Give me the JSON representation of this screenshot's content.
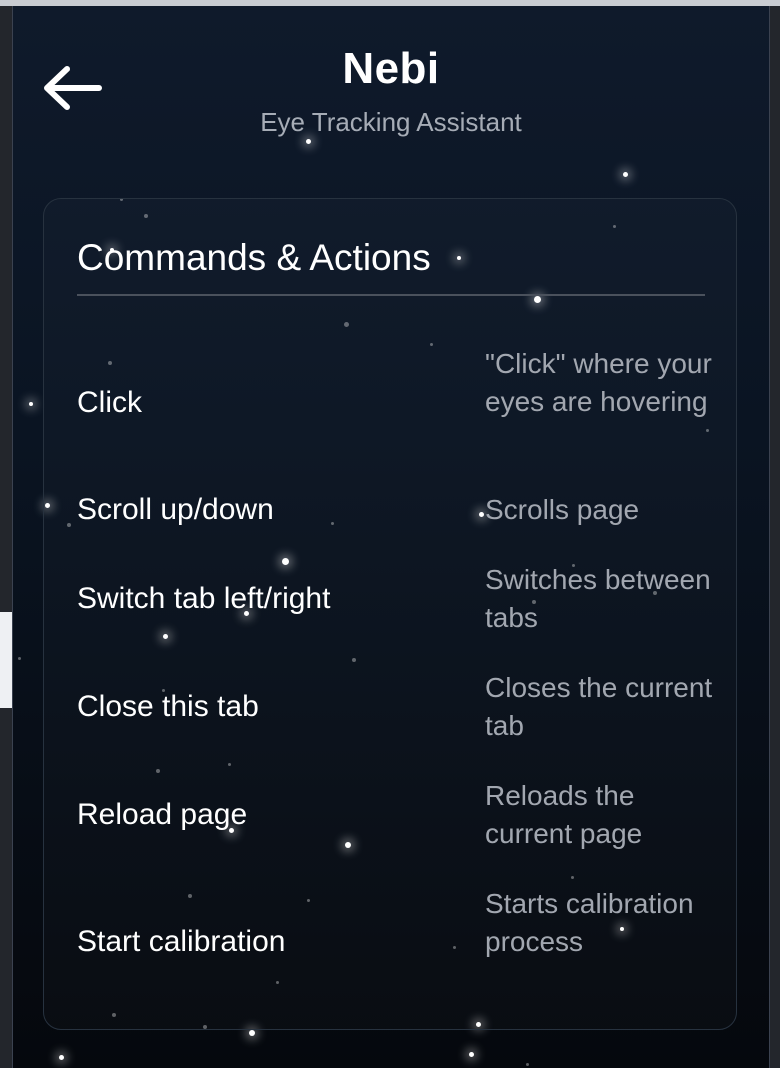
{
  "header": {
    "title": "Nebi",
    "subtitle": "Eye Tracking Assistant",
    "back_icon": "arrow-left-icon"
  },
  "card": {
    "title": "Commands & Actions"
  },
  "commands": [
    {
      "name": "Click",
      "desc": "\"Click\" where your eyes are hovering"
    },
    {
      "name": "Scroll up/down",
      "desc": "Scrolls page"
    },
    {
      "name": "Switch tab left/right",
      "desc": "Switches between tabs"
    },
    {
      "name": "Close this tab",
      "desc": "Closes the current tab"
    },
    {
      "name": "Reload page",
      "desc": "Reloads the current page"
    },
    {
      "name": "Start calibration",
      "desc": "Starts calibration process"
    }
  ],
  "colors": {
    "panel_top": "#0f1a2b",
    "panel_bottom": "#05080d",
    "text_primary": "#ffffff",
    "text_secondary": "#a2a7b0"
  }
}
